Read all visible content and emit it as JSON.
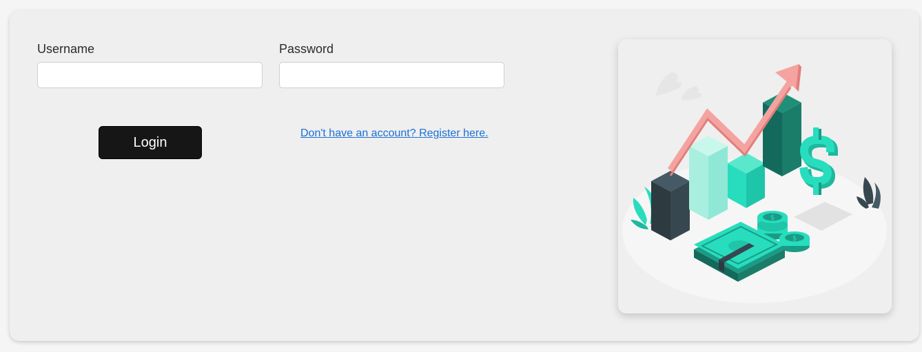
{
  "form": {
    "username_label": "Username",
    "username_value": "",
    "password_label": "Password",
    "password_value": "",
    "login_label": "Login",
    "register_link_text": "Don't have an account? Register here."
  },
  "illustration": {
    "icon": "finance-growth-illustration",
    "colors": {
      "accent": "#27ddbd",
      "dark_teal": "#136a5c",
      "arrow": "#f5a3a0",
      "dark_bar": "#37474f"
    }
  }
}
